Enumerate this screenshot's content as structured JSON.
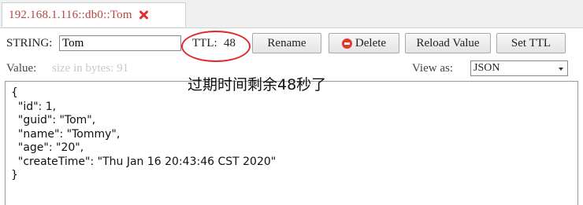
{
  "tab": {
    "title": "192.168.1.116::db0::Tom",
    "close_icon": "close-icon",
    "close_color": "#e03030",
    "title_color": "#b8443e"
  },
  "toolbar": {
    "type_label": "STRING:",
    "key_value": "Tom",
    "ttl_label": "TTL:",
    "ttl_value": "48",
    "rename_label": "Rename",
    "delete_label": "Delete",
    "reload_label": "Reload Valuе",
    "set_ttl_label": "Set TTL",
    "delete_icon": "delete-icon"
  },
  "value_row": {
    "value_label": "Value:",
    "size_text": "size in bytes: 91",
    "view_as_label": "View as:",
    "view_as_selected": "JSON"
  },
  "annotation": {
    "text": "过期时间剩余48秒了",
    "circle_color": "#e02a2a"
  },
  "editor": {
    "lines": [
      "{",
      "  \"id\": 1,",
      "  \"guid\": \"Tom\",",
      "  \"name\": \"Tommy\",",
      "  \"age\": \"20\",",
      "  \"createTime\": \"Thu Jan 16 20:43:46 CST 2020\"",
      "}"
    ]
  }
}
